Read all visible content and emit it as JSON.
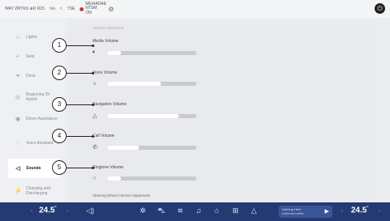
{
  "status_bar": {
    "left_text": "WAY  ZMTKS  ⊕D  R15",
    "items": [
      "⅓o",
      "≈",
      "TSE"
    ],
    "alert_text": "MEIAADAE  NTSM ON",
    "gear_icon": "gear-icon",
    "power_icon": "power-icon"
  },
  "sidebar": {
    "items": [
      {
        "label": "Lights",
        "icon": "light-icon"
      },
      {
        "label": "Seat",
        "icon": "seat-icon"
      },
      {
        "label": "Drive",
        "icon": "drive-icon"
      },
      {
        "label": "Beginning Of Assist",
        "icon": "assist-icon"
      },
      {
        "label": "Driver Assistance",
        "icon": "driver-assist-icon"
      },
      {
        "label": "Voice Assistant",
        "icon": "voice-icon"
      },
      {
        "label": "Sounds",
        "icon": "sound-icon",
        "active": true
      },
      {
        "label": "Charging and Discharging",
        "icon": "charging-icon"
      }
    ]
  },
  "panel": {
    "title": "Volume Adjustment",
    "volumes": [
      {
        "label": "Media Volume",
        "icon": "speaker-icon",
        "level": 0.15
      },
      {
        "label": "Voice Volume",
        "icon": "microphone-icon",
        "level": 0.6
      },
      {
        "label": "Navigation Volume",
        "icon": "navigation-icon",
        "level": 0.8
      },
      {
        "label": "Call Volume",
        "icon": "phone-icon",
        "level": 0.35
      },
      {
        "label": "Ringtone Volume",
        "icon": "bell-icon",
        "level": 0.15
      }
    ],
    "callouts": [
      "1",
      "2",
      "3",
      "4",
      "5"
    ],
    "steering_label": "Steering Wheel Volume Adjustment"
  },
  "dock": {
    "left_temp": "24.5",
    "right_temp": "24.5",
    "temp_unit": "°",
    "media_title": "Nothing Here",
    "media_subtitle": "Unknown artist",
    "icons": [
      "speaker-icon",
      "fan-icon",
      "car-icon",
      "seat-heat-icon",
      "music-icon",
      "home-icon",
      "grid-icon",
      "navigation-icon"
    ]
  }
}
